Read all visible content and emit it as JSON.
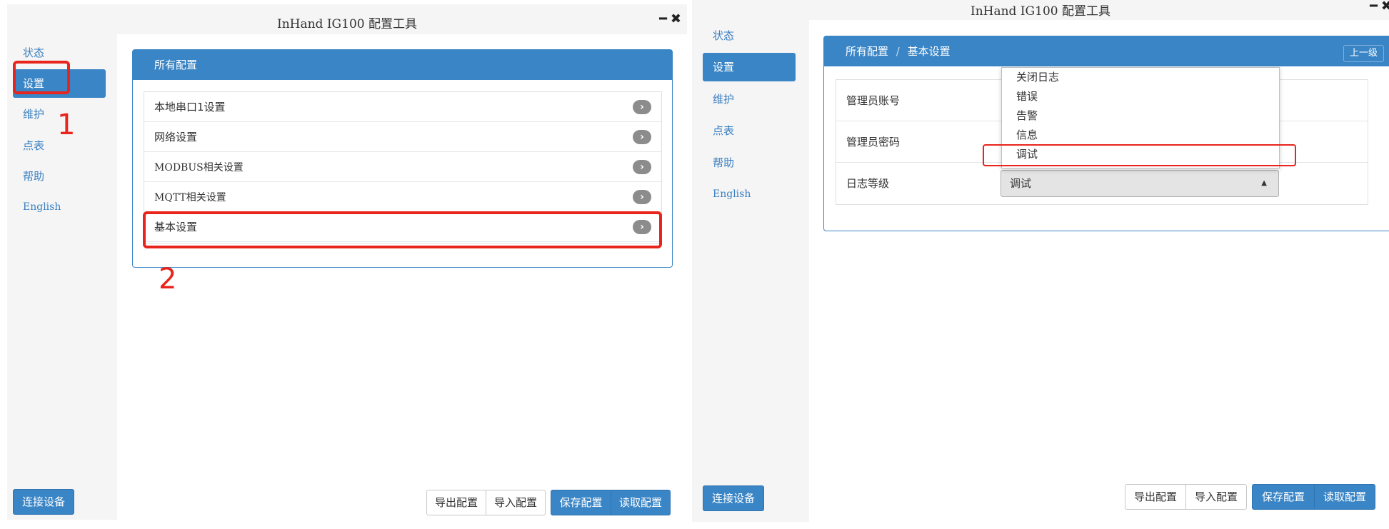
{
  "left": {
    "title": "InHand IG100 配置工具",
    "minimize": "━",
    "close": "✖",
    "sidebar": [
      {
        "label": "状态"
      },
      {
        "label": "设置"
      },
      {
        "label": "维护"
      },
      {
        "label": "点表"
      },
      {
        "label": "帮助"
      },
      {
        "label": "English"
      }
    ],
    "panel_title": "所有配置",
    "config_items": [
      {
        "label": "本地串口1设置"
      },
      {
        "label": "网络设置"
      },
      {
        "label": "MODBUS相关设置"
      },
      {
        "label": "MQTT相关设置"
      },
      {
        "label": "基本设置"
      }
    ],
    "connect_button": "连接设备",
    "footer_buttons": {
      "export": "导出配置",
      "import": "导入配置",
      "save": "保存配置",
      "read": "读取配置"
    },
    "annotations": {
      "step1": "1",
      "step2": "2"
    }
  },
  "right": {
    "title": "InHand IG100 配置工具",
    "minimize": "━",
    "close": "✖",
    "sidebar": [
      {
        "label": "状态"
      },
      {
        "label": "设置"
      },
      {
        "label": "维护"
      },
      {
        "label": "点表"
      },
      {
        "label": "帮助"
      },
      {
        "label": "English"
      }
    ],
    "breadcrumb": {
      "root": "所有配置",
      "separator": "/",
      "current": "基本设置"
    },
    "up_button": "上一级",
    "fields": [
      {
        "label": "管理员账号"
      },
      {
        "label": "管理员密码"
      },
      {
        "label": "日志等级",
        "value": "调试"
      }
    ],
    "dropdown_options": [
      "关闭日志",
      "错误",
      "告警",
      "信息",
      "调试"
    ],
    "connect_button": "连接设备",
    "footer_buttons": {
      "export": "导出配置",
      "import": "导入配置",
      "save": "保存配置",
      "read": "读取配置"
    }
  },
  "icons": {
    "chevron": "chevron-right-icon",
    "caret": "caret-up-icon"
  },
  "colors": {
    "accent": "#3a85c6",
    "annotation": "#e8241c"
  }
}
